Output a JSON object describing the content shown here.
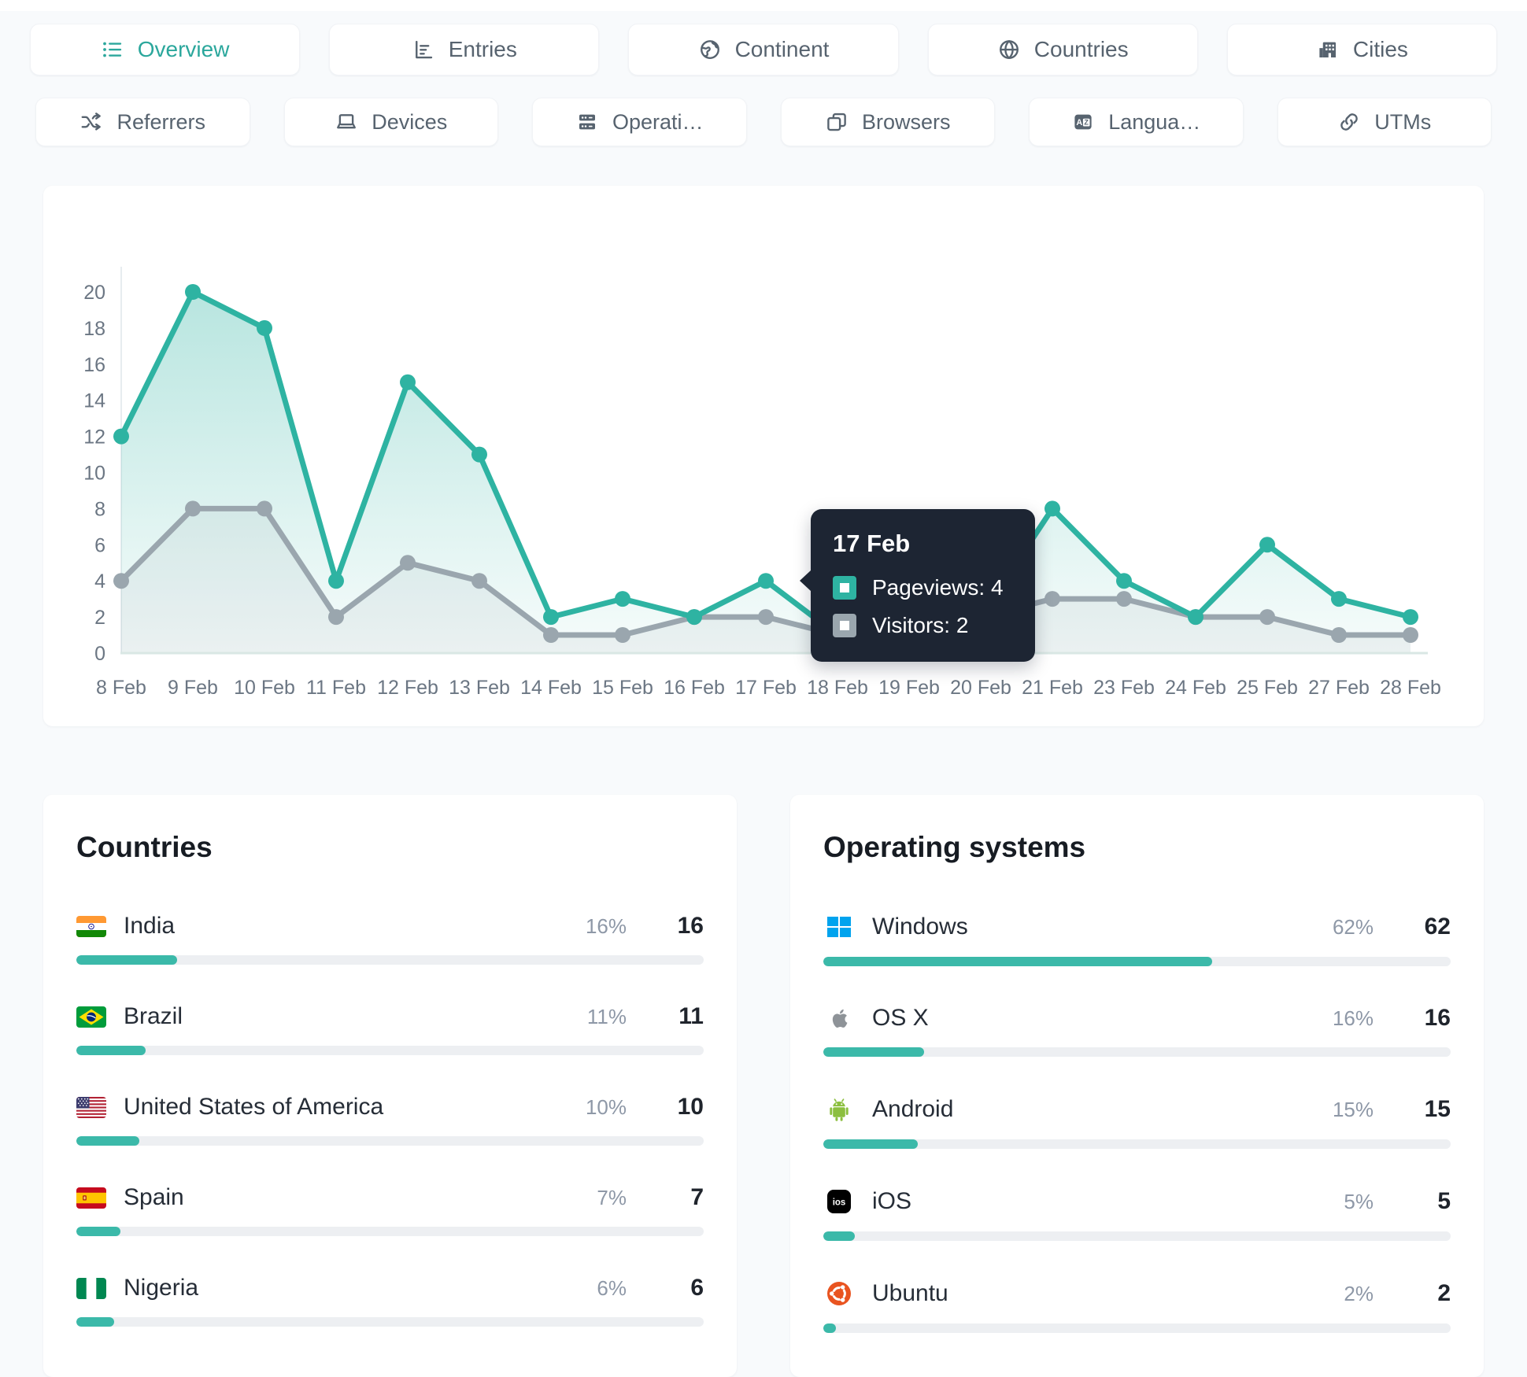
{
  "page": {
    "bg": "#f8fafc",
    "accent": "#2eb3a2"
  },
  "primary_tabs": [
    {
      "label": "Overview",
      "icon": "list-icon",
      "active": true
    },
    {
      "label": "Entries",
      "icon": "bar-chart-icon",
      "active": false
    },
    {
      "label": "Continent",
      "icon": "earth-icon",
      "active": false
    },
    {
      "label": "Countries",
      "icon": "globe-icon",
      "active": false
    },
    {
      "label": "Cities",
      "icon": "buildings-icon",
      "active": false
    }
  ],
  "secondary_tabs": [
    {
      "label": "Referrers",
      "icon": "shuffle-icon",
      "active": false
    },
    {
      "label": "Devices",
      "icon": "laptop-icon",
      "active": false
    },
    {
      "label": "Operati…",
      "icon": "server-icon",
      "active": false
    },
    {
      "label": "Browsers",
      "icon": "browser-icon",
      "active": false
    },
    {
      "label": "Langua…",
      "icon": "translate-icon",
      "active": false
    },
    {
      "label": "UTMs",
      "icon": "link-icon",
      "active": false
    }
  ],
  "chart_data": {
    "type": "line",
    "categories": [
      "8 Feb",
      "9 Feb",
      "10 Feb",
      "11 Feb",
      "12 Feb",
      "13 Feb",
      "14 Feb",
      "15 Feb",
      "16 Feb",
      "17 Feb",
      "18 Feb",
      "19 Feb",
      "20 Feb",
      "21 Feb",
      "23 Feb",
      "24 Feb",
      "25 Feb",
      "27 Feb",
      "28 Feb"
    ],
    "series": [
      {
        "name": "Pageviews",
        "color": "#2eb3a2",
        "values": [
          12,
          20,
          18,
          4,
          15,
          11,
          2,
          3,
          2,
          4,
          1,
          1,
          2,
          8,
          4,
          2,
          6,
          3,
          2
        ]
      },
      {
        "name": "Visitors",
        "color": "#9aa6ae",
        "values": [
          4,
          8,
          8,
          2,
          5,
          4,
          1,
          1,
          2,
          2,
          1,
          1,
          2,
          3,
          3,
          2,
          2,
          1,
          1
        ]
      }
    ],
    "ylim": [
      0,
      20
    ],
    "ytick_step": 2,
    "grid": false,
    "legend_position": "none",
    "tooltip": {
      "title": "17 Feb",
      "anchor_index": 9,
      "rows": [
        {
          "label": "Pageviews: 4",
          "color": "#2eb3a2"
        },
        {
          "label": "Visitors: 2",
          "color": "#9aa6ae"
        }
      ]
    }
  },
  "countries_panel": {
    "title": "Countries",
    "rows": [
      {
        "label": "India",
        "icon": "flag-india",
        "percent": "16%",
        "percent_value": 16,
        "count": "16"
      },
      {
        "label": "Brazil",
        "icon": "flag-brazil",
        "percent": "11%",
        "percent_value": 11,
        "count": "11"
      },
      {
        "label": "United States of America",
        "icon": "flag-usa",
        "percent": "10%",
        "percent_value": 10,
        "count": "10"
      },
      {
        "label": "Spain",
        "icon": "flag-spain",
        "percent": "7%",
        "percent_value": 7,
        "count": "7"
      },
      {
        "label": "Nigeria",
        "icon": "flag-nigeria",
        "percent": "6%",
        "percent_value": 6,
        "count": "6"
      }
    ]
  },
  "os_panel": {
    "title": "Operating systems",
    "rows": [
      {
        "label": "Windows",
        "icon": "windows-icon",
        "percent": "62%",
        "percent_value": 62,
        "count": "62"
      },
      {
        "label": "OS X",
        "icon": "apple-icon",
        "percent": "16%",
        "percent_value": 16,
        "count": "16"
      },
      {
        "label": "Android",
        "icon": "android-icon",
        "percent": "15%",
        "percent_value": 15,
        "count": "15"
      },
      {
        "label": "iOS",
        "icon": "ios-icon",
        "percent": "5%",
        "percent_value": 5,
        "count": "5"
      },
      {
        "label": "Ubuntu",
        "icon": "ubuntu-icon",
        "percent": "2%",
        "percent_value": 2,
        "count": "2"
      }
    ]
  },
  "colors": {
    "progress_fill": "#3bb9a9",
    "progress_track": "#edeff2",
    "tooltip_bg": "#1d2533",
    "gray_series": "#9aa6ae"
  }
}
